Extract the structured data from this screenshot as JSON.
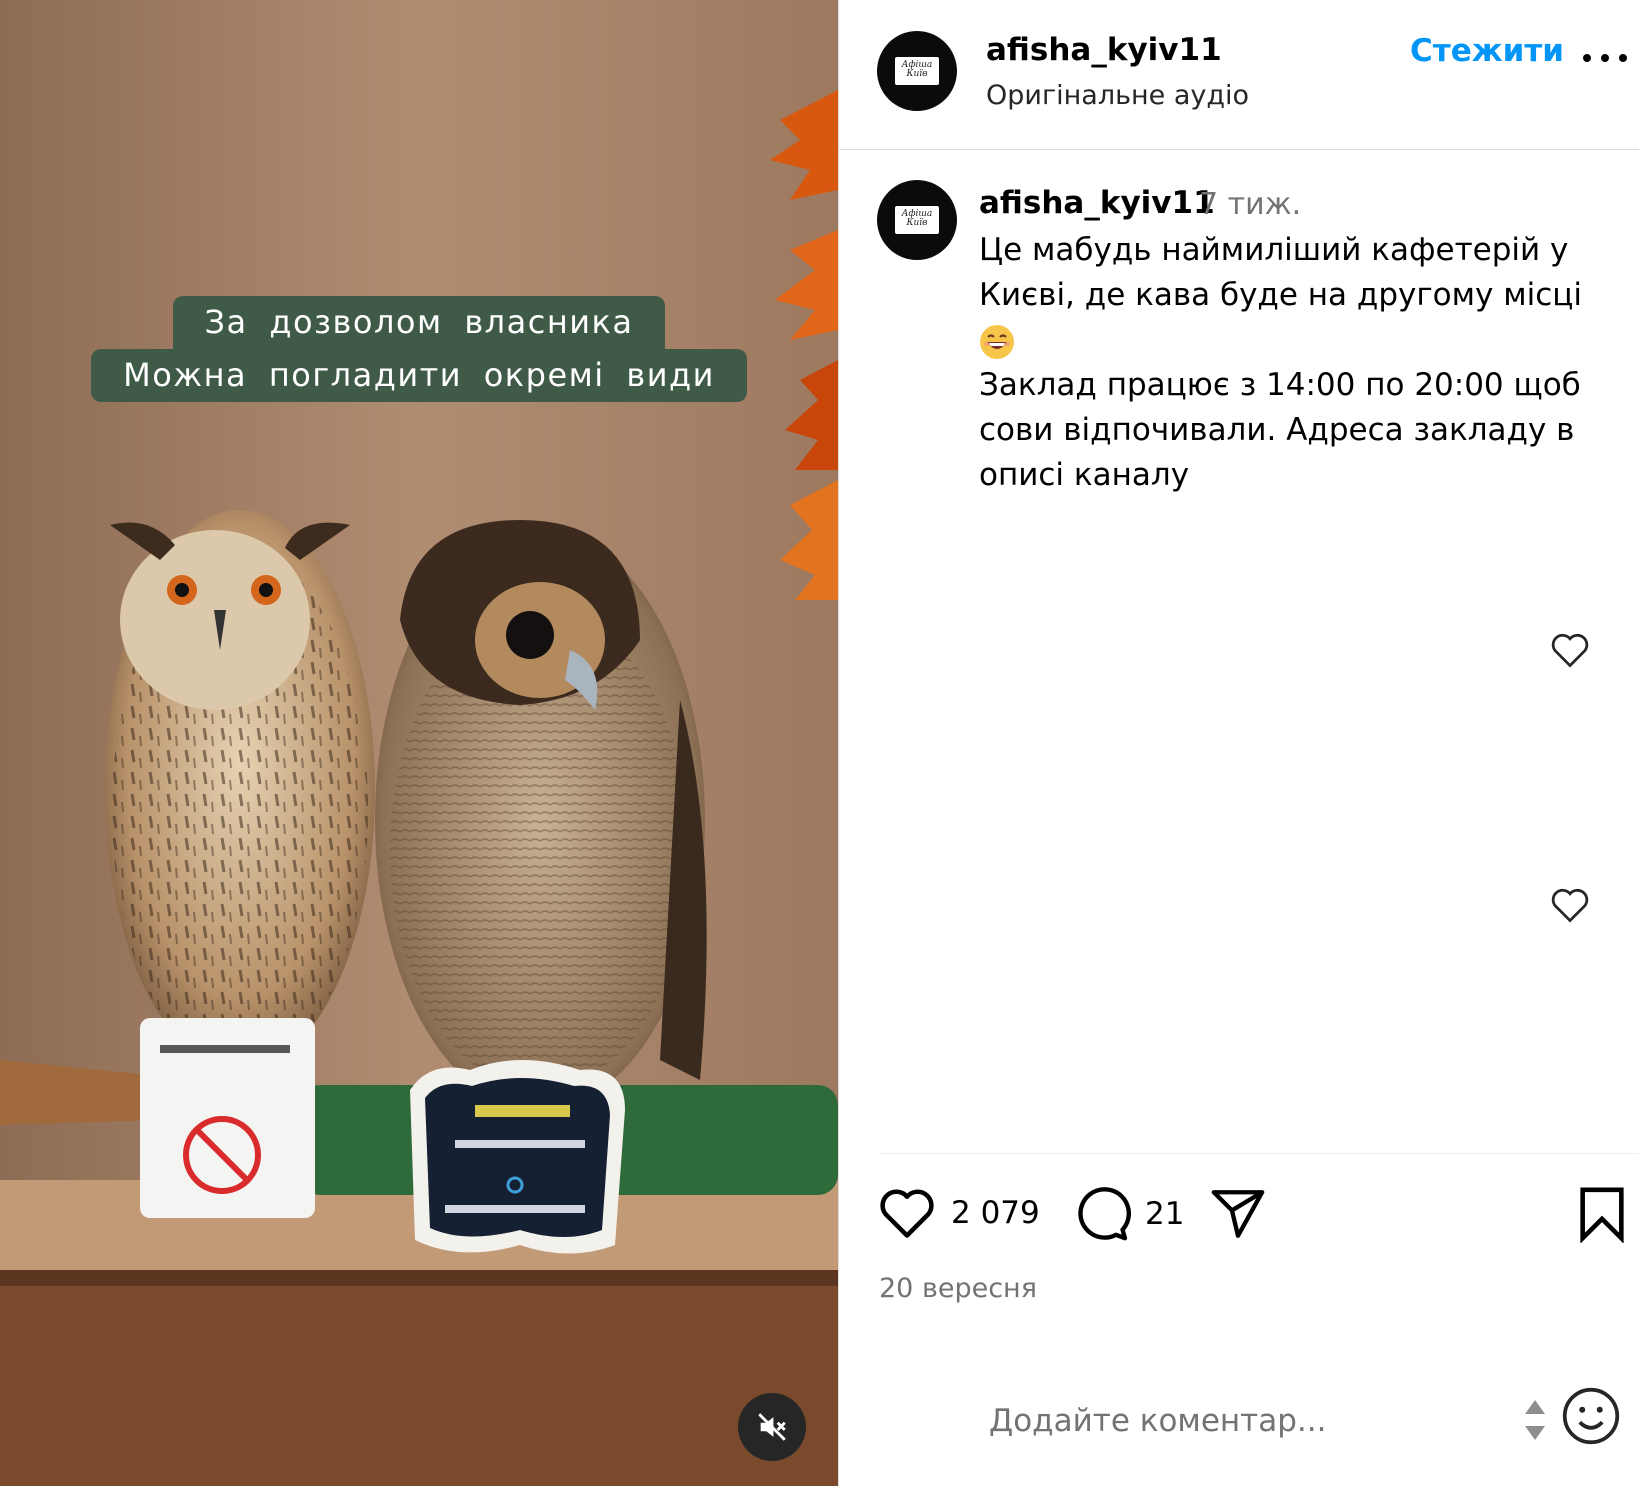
{
  "media": {
    "overlay_line1": "За дозволом власника",
    "overlay_line2": "Можна погладити окремі види",
    "mute_icon": "speaker-muted-icon"
  },
  "header": {
    "username": "afisha_kyiv11",
    "audio": "Оригінальне аудіо",
    "follow_label": "Стежити",
    "more_icon": "more-horizontal-icon",
    "avatar_text": "Афіша Київ"
  },
  "caption": {
    "username": "afisha_kyiv11",
    "time": "7 тиж.",
    "line1": "Це мабудь наймиліший кафетерій у Києві, де кава буде на другому місці",
    "emoji": "smiling-face-with-open-mouth-icon",
    "line2": "Заклад працює з 14:00 по 20:00 щоб сови відпочивали. Адреса закладу в описі каналу"
  },
  "actions": {
    "likes": "2 079",
    "comments": "21",
    "icons": [
      "heart-icon",
      "comment-icon",
      "share-icon",
      "bookmark-icon"
    ]
  },
  "date": "20 вересня",
  "comment_input": {
    "placeholder": "Додайте коментар..."
  },
  "colors": {
    "accent": "#0095f6",
    "overlay_bg": "#3f5a47",
    "muted_text": "#737373"
  }
}
